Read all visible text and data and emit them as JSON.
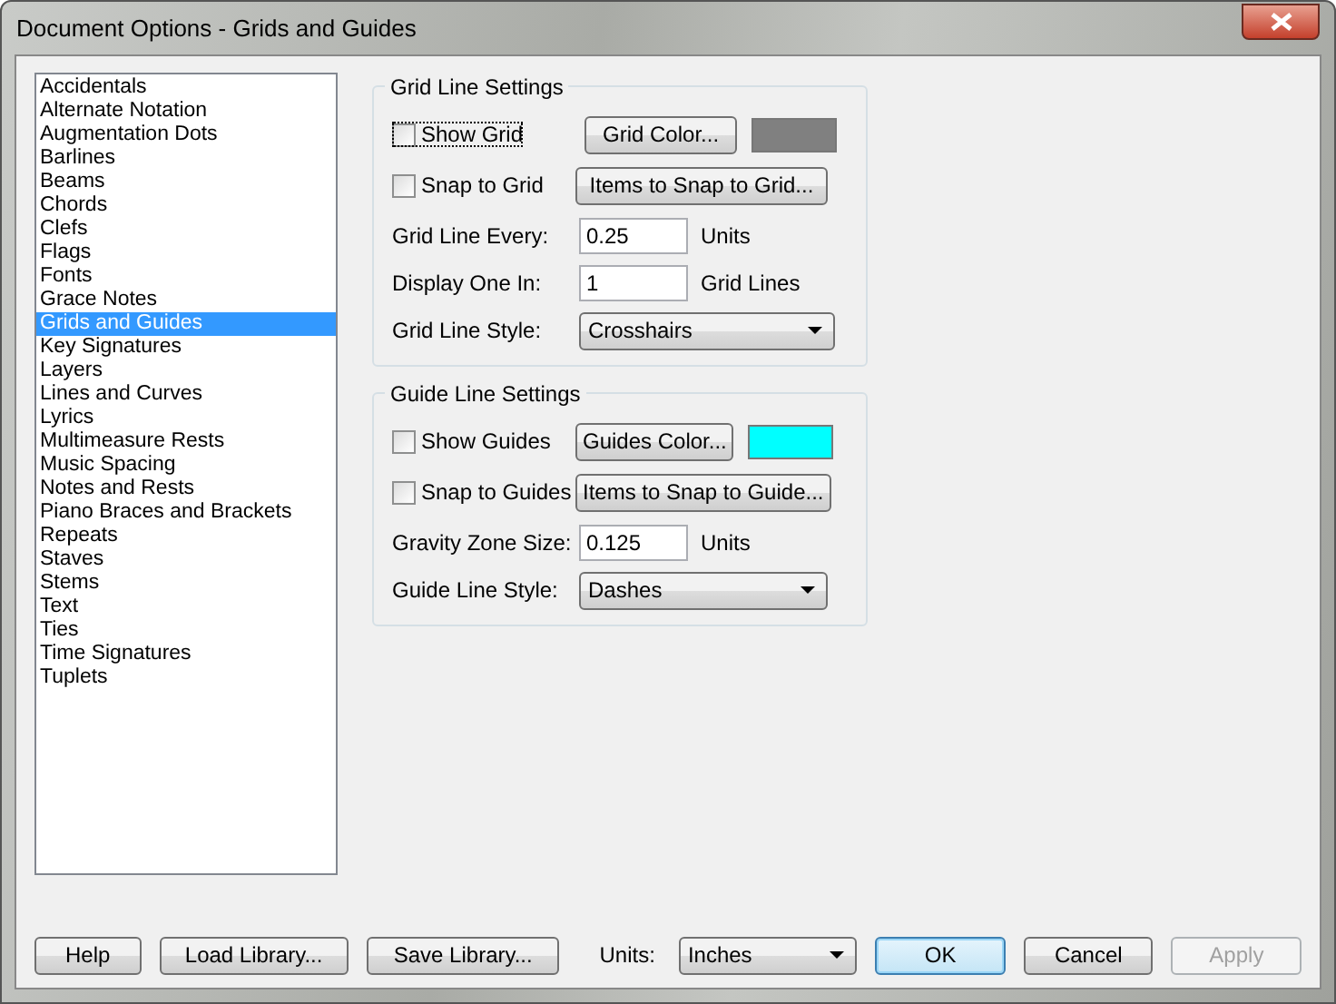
{
  "window": {
    "title": "Document Options - Grids and Guides"
  },
  "categories": [
    {
      "label": "Accidentals",
      "selected": false
    },
    {
      "label": "Alternate Notation",
      "selected": false
    },
    {
      "label": "Augmentation Dots",
      "selected": false
    },
    {
      "label": "Barlines",
      "selected": false
    },
    {
      "label": "Beams",
      "selected": false
    },
    {
      "label": "Chords",
      "selected": false
    },
    {
      "label": "Clefs",
      "selected": false
    },
    {
      "label": "Flags",
      "selected": false
    },
    {
      "label": "Fonts",
      "selected": false
    },
    {
      "label": "Grace Notes",
      "selected": false
    },
    {
      "label": "Grids and Guides",
      "selected": true
    },
    {
      "label": "Key Signatures",
      "selected": false
    },
    {
      "label": "Layers",
      "selected": false
    },
    {
      "label": "Lines and Curves",
      "selected": false
    },
    {
      "label": "Lyrics",
      "selected": false
    },
    {
      "label": "Multimeasure Rests",
      "selected": false
    },
    {
      "label": "Music Spacing",
      "selected": false
    },
    {
      "label": "Notes and Rests",
      "selected": false
    },
    {
      "label": "Piano Braces and Brackets",
      "selected": false
    },
    {
      "label": "Repeats",
      "selected": false
    },
    {
      "label": "Staves",
      "selected": false
    },
    {
      "label": "Stems",
      "selected": false
    },
    {
      "label": "Text",
      "selected": false
    },
    {
      "label": "Ties",
      "selected": false
    },
    {
      "label": "Time Signatures",
      "selected": false
    },
    {
      "label": "Tuplets",
      "selected": false
    }
  ],
  "groups": [
    {
      "title": "Grid Line Settings",
      "show": {
        "label": "Show Grid",
        "checked": false,
        "focused": true
      },
      "color_button": "Grid Color...",
      "color": "#808080",
      "snap": {
        "label": "Snap to Grid",
        "checked": false,
        "focused": false
      },
      "snap_button": "Items to Snap to Grid...",
      "fields": [
        {
          "kind": "input",
          "label": "Grid Line Every:",
          "value": "0.25",
          "unit": "Units"
        },
        {
          "kind": "input",
          "label": "Display One In:",
          "value": "1",
          "unit": "Grid Lines"
        },
        {
          "kind": "select",
          "label": "Grid Line Style:",
          "value": "Crosshairs"
        }
      ]
    },
    {
      "title": "Guide Line Settings",
      "show": {
        "label": "Show Guides",
        "checked": false,
        "focused": false
      },
      "color_button": "Guides Color...",
      "color": "#00ffff",
      "snap": {
        "label": "Snap to Guides",
        "checked": false,
        "focused": false
      },
      "snap_button": "Items to Snap to Guide...",
      "fields": [
        {
          "kind": "input",
          "label": "Gravity Zone Size:",
          "value": "0.125",
          "unit": "Units"
        },
        {
          "kind": "select",
          "label": "Guide Line Style:",
          "value": "Dashes"
        }
      ]
    }
  ],
  "footer": {
    "buttons_left": [
      "Help",
      "Load Library...",
      "Save Library..."
    ],
    "units_label": "Units:",
    "units_value": "Inches",
    "buttons_right": [
      {
        "label": "OK",
        "default": true,
        "disabled": false
      },
      {
        "label": "Cancel",
        "default": false,
        "disabled": false
      },
      {
        "label": "Apply",
        "default": false,
        "disabled": true
      }
    ]
  }
}
